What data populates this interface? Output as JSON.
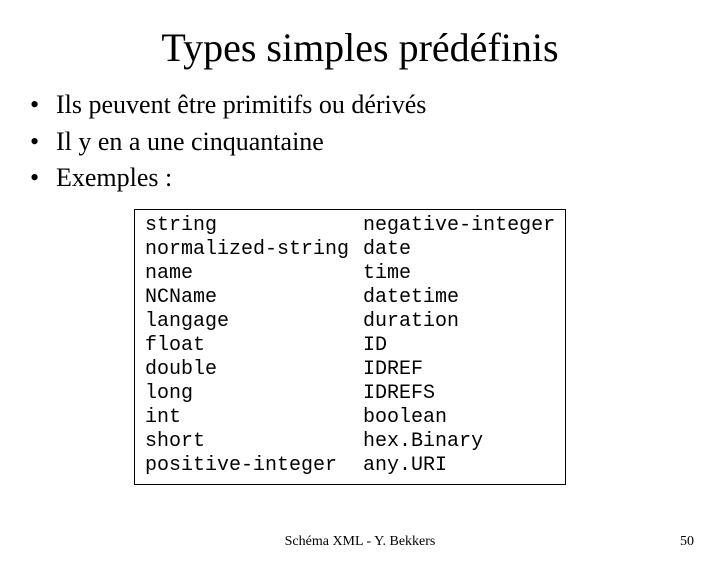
{
  "title": "Types simples prédéfinis",
  "bullets": [
    "Ils peuvent être primitifs ou dérivés",
    "Il y en a une cinquantaine",
    "Exemples :"
  ],
  "types_col1": "string\nnormalized-string\nname\nNCName\nlangage\nfloat\ndouble\nlong\nint\nshort\npositive-integer",
  "types_col2": "negative-integer\ndate\ntime\ndatetime\nduration\nID\nIDREF\nIDREFS\nboolean\nhex.Binary\nany.URI",
  "footer_center": "Schéma XML - Y. Bekkers",
  "footer_right": "50"
}
